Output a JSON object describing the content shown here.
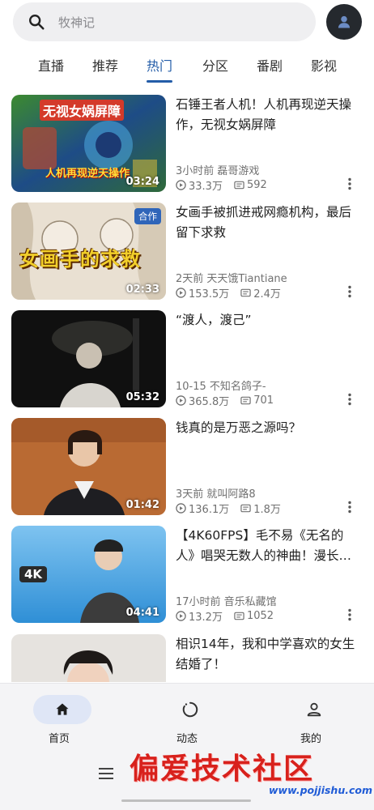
{
  "search": {
    "placeholder": "牧神记"
  },
  "tabs": [
    {
      "label": "直播"
    },
    {
      "label": "推荐"
    },
    {
      "label": "热门"
    },
    {
      "label": "分区"
    },
    {
      "label": "番剧"
    },
    {
      "label": "影视"
    }
  ],
  "active_tab": "热门",
  "colors": {
    "accent": "#245da8",
    "badge": "#2f65b9",
    "watermark": "#d8211c"
  },
  "videos": [
    {
      "title": "石锤王者人机！人机再现逆天操作，无视女娲屏障",
      "duration": "03:24",
      "meta": "3小时前 磊哥游戏",
      "views": "33.3万",
      "comments": "592",
      "thumb_text_top": "无视女娲屏障",
      "thumb_text_bottom": "人机再现逆天操作"
    },
    {
      "title": "女画手被抓进戒网瘾机构，最后留下求救",
      "duration": "02:33",
      "badge": "合作",
      "meta": "2天前 天天饿Tiantiane",
      "views": "153.5万",
      "comments": "2.4万",
      "thumb_text": "女画手的求救"
    },
    {
      "title": "“渡人，渡己”",
      "duration": "05:32",
      "meta": "10-15 不知名鸽子-",
      "views": "365.8万",
      "comments": "701"
    },
    {
      "title": "钱真的是万恶之源吗？",
      "duration": "01:42",
      "meta": "3天前 就叫阿路8",
      "views": "136.1万",
      "comments": "1.8万"
    },
    {
      "title": "【4K60FPS】毛不易《无名的人》唱哭无数人的神曲！漫长…",
      "duration": "04:41",
      "meta": "17小时前 音乐私藏馆",
      "views": "13.2万",
      "comments": "1052",
      "thumb_text": "4K"
    },
    {
      "title": "相识14年，我和中学喜欢的女生结婚了！"
    }
  ],
  "bottom_nav": [
    {
      "label": "首页",
      "icon": "home-icon"
    },
    {
      "label": "动态",
      "icon": "activity-icon"
    },
    {
      "label": "我的",
      "icon": "profile-icon"
    }
  ],
  "watermark": {
    "text": "偏爱技术社区",
    "url": "www.pojjishu.com"
  }
}
